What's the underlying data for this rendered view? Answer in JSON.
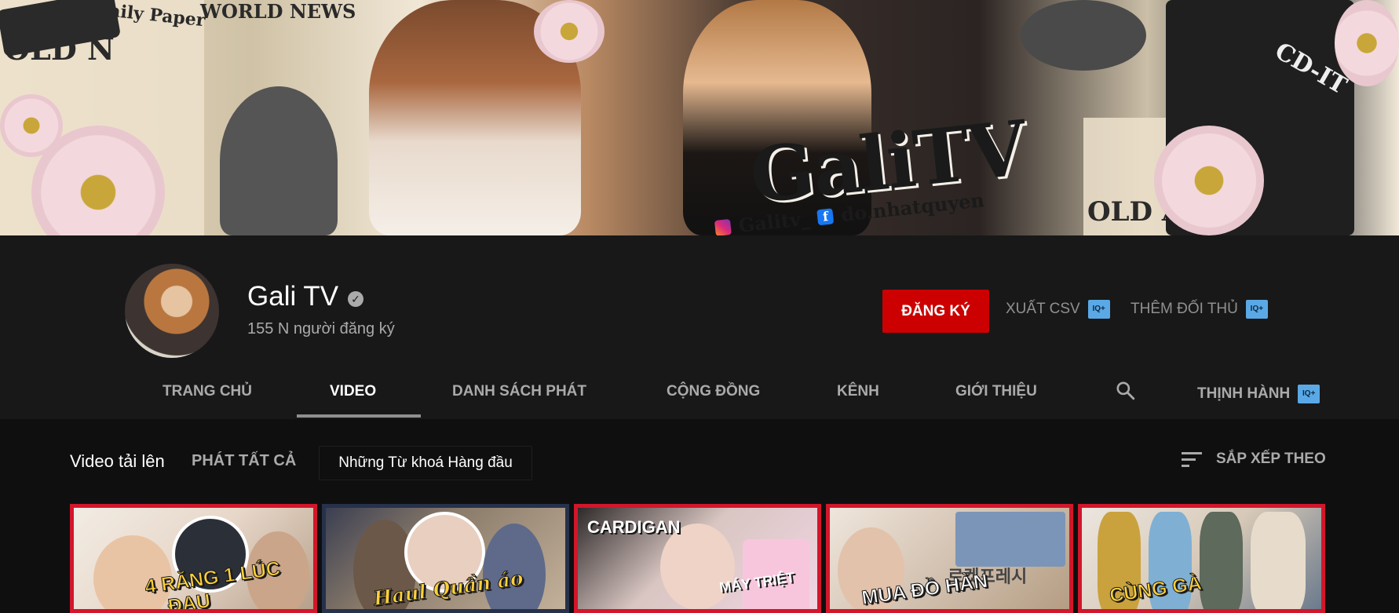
{
  "banner": {
    "logo_text": "GaliTV",
    "instagram_handle": "Galitv_",
    "facebook_handle": "do.nhatquyen",
    "news_texts": [
      "Daily Paper",
      "WORLD NEWS",
      "WORLD NEWS",
      "OLD N"
    ]
  },
  "channel": {
    "name": "Gali TV",
    "subscribers": "155 N người đăng ký",
    "subscribe_label": "ĐĂNG KÝ",
    "export_csv_label": "XUẤT CSV",
    "add_competitor_label": "THÊM ĐỐI THỦ",
    "iq_badge": "IQ+"
  },
  "tabs": [
    {
      "label": "TRANG CHỦ"
    },
    {
      "label": "VIDEO"
    },
    {
      "label": "DANH SÁCH PHÁT"
    },
    {
      "label": "CỘNG ĐỒNG"
    },
    {
      "label": "KÊNH"
    },
    {
      "label": "GIỚI THIỆU"
    },
    {
      "label": "THỊNH HÀNH"
    }
  ],
  "uploads": {
    "title": "Video tải lên",
    "play_all": "PHÁT TẤT CẢ",
    "keyword_chip": "Những Từ khoá Hàng đầu",
    "sort_label": "SẮP XẾP THEO"
  },
  "thumbnails": [
    {
      "caption": "4 RĂNG 1 LÚC",
      "caption2": "ĐAU"
    },
    {
      "caption": "Haul Quần áo",
      "caption2": ""
    },
    {
      "caption": "CARDIGAN",
      "caption2": "MÁY TRIỆT"
    },
    {
      "caption": "MUA ĐỒ HÀN",
      "caption2": "로켓프레시"
    },
    {
      "caption": "CÙNG GÀ",
      "caption2": ""
    }
  ],
  "colors": {
    "subscribe_red": "#cc0000",
    "iq_blue": "#5aa9e6",
    "thumb_border": "#d2162b"
  }
}
